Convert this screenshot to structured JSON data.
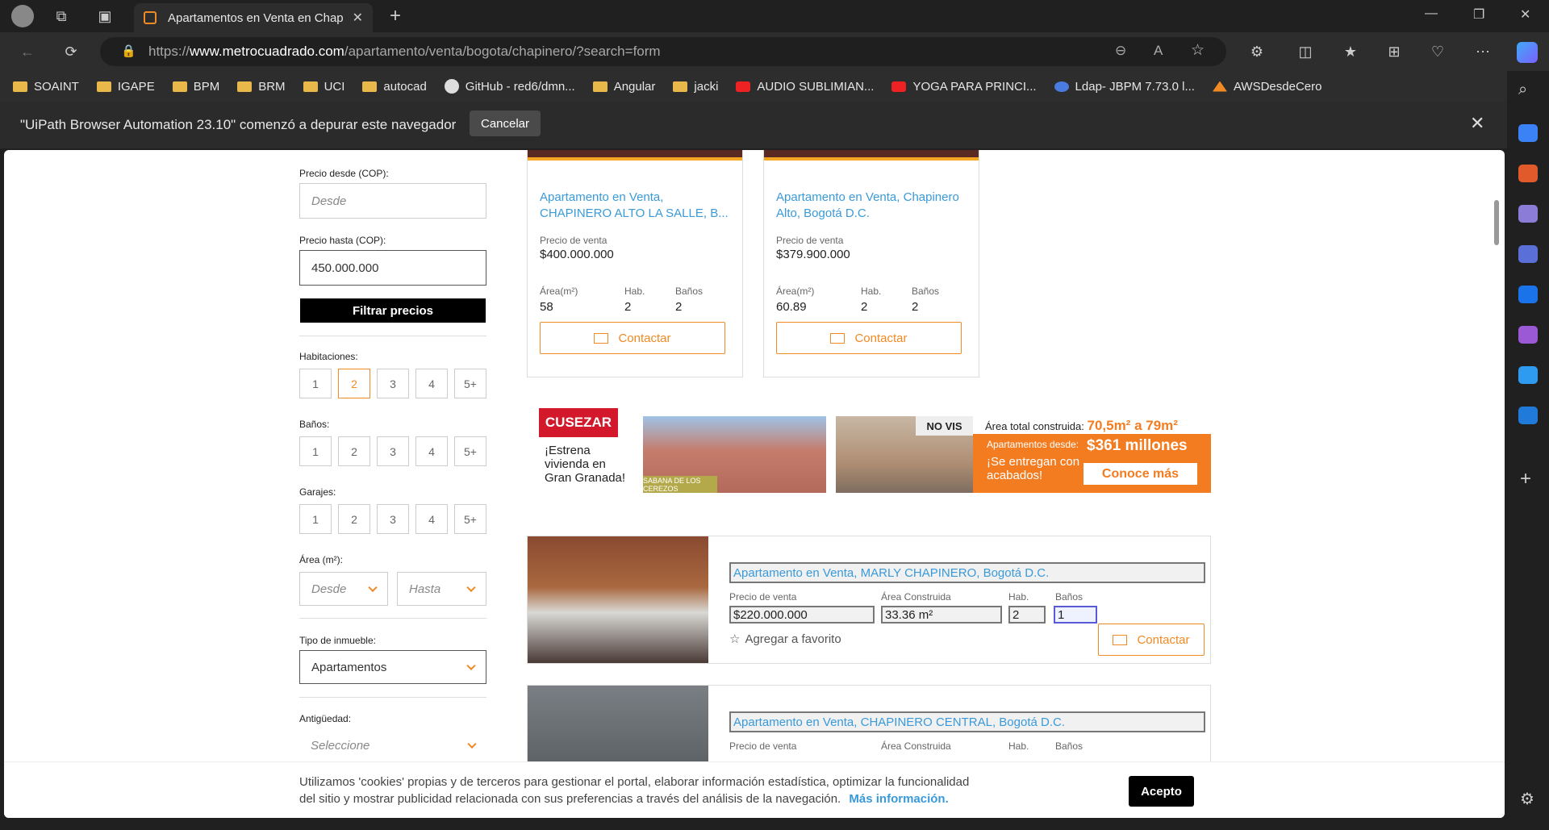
{
  "browser": {
    "tab_title": "Apartamentos en Venta en Chap",
    "url_prefix": "https://",
    "url_domain": "www.metrocuadrado.com",
    "url_path": "/apartamento/venta/bogota/chapinero/?search=form",
    "bookmarks": [
      {
        "label": "SOAINT",
        "icon": "folder-icon"
      },
      {
        "label": "IGAPE",
        "icon": "folder-icon"
      },
      {
        "label": "BPM",
        "icon": "folder-icon"
      },
      {
        "label": "BRM",
        "icon": "folder-icon"
      },
      {
        "label": "UCI",
        "icon": "folder-icon"
      },
      {
        "label": "autocad",
        "icon": "folder-icon"
      },
      {
        "label": "GitHub - red6/dmn...",
        "icon": "github-icon"
      },
      {
        "label": "Angular",
        "icon": "folder-icon"
      },
      {
        "label": "jacki",
        "icon": "folder-icon"
      },
      {
        "label": "AUDIO SUBLIMIAN...",
        "icon": "youtube-icon"
      },
      {
        "label": "YOGA PARA PRINCI...",
        "icon": "youtube-icon"
      },
      {
        "label": "Ldap- JBPM 7.73.0 l...",
        "icon": "people-icon"
      },
      {
        "label": "AWSDesdeCero",
        "icon": "aws-icon"
      }
    ],
    "infobar_text": "\"UiPath Browser Automation 23.10\" comenzó a depurar este navegador",
    "infobar_cancel": "Cancelar"
  },
  "filters": {
    "precio_desde_label": "Precio desde (COP):",
    "precio_desde_placeholder": "Desde",
    "precio_hasta_label": "Precio hasta (COP):",
    "precio_hasta_value": "450.000.000",
    "filtrar_label": "Filtrar precios",
    "habitaciones_label": "Habitaciones:",
    "habitaciones_options": [
      "1",
      "2",
      "3",
      "4",
      "5+"
    ],
    "habitaciones_selected": "2",
    "banos_label": "Baños:",
    "banos_options": [
      "1",
      "2",
      "3",
      "4",
      "5+"
    ],
    "garajes_label": "Garajes:",
    "garajes_options": [
      "1",
      "2",
      "3",
      "4",
      "5+"
    ],
    "area_label": "Área (m²):",
    "area_desde": "Desde",
    "area_hasta": "Hasta",
    "tipo_label": "Tipo de inmueble:",
    "tipo_value": "Apartamentos",
    "antiguedad_label": "Antigüedad:",
    "antiguedad_value": "Seleccione"
  },
  "grid_cards": [
    {
      "title": "Apartamento en Venta, CHAPINERO ALTO LA SALLE, B...",
      "price_label": "Precio de venta",
      "price": "$400.000.000",
      "area_label": "Área(m²)",
      "area": "58",
      "hab_label": "Hab.",
      "hab": "2",
      "banos_label": "Baños",
      "banos": "2",
      "contact": "Contactar"
    },
    {
      "title": "Apartamento en Venta, Chapinero Alto, Bogotá D.C.",
      "price_label": "Precio de venta",
      "price": "$379.900.000",
      "area_label": "Área(m²)",
      "area": "60.89",
      "hab_label": "Hab.",
      "hab": "2",
      "banos_label": "Baños",
      "banos": "2",
      "contact": "Contactar"
    }
  ],
  "ad": {
    "brand": "CUSEZAR",
    "tagline": "¡Estrena vivienda en Gran Granada!",
    "project": "SABANA DE LOS CEREZOS",
    "badge": "NO VIS",
    "area_text": "Área total construida:",
    "area_value": "70,5m² a 79m²",
    "desde_text": "Apartamentos desde:",
    "price": "$361 millones",
    "entregan": "¡Se entregan con acabados!",
    "cta": "Conoce más"
  },
  "list_cards": [
    {
      "title": "Apartamento en Venta, MARLY CHAPINERO, Bogotá D.C.",
      "price_label": "Precio de venta",
      "price": "$220.000.000",
      "area_label": "Área Construida",
      "area": "33.36 m²",
      "hab_label": "Hab.",
      "hab": "2",
      "banos_label": "Baños",
      "banos": "1",
      "fav": "Agregar a favorito",
      "contact": "Contactar"
    },
    {
      "title": "Apartamento en Venta, CHAPINERO CENTRAL, Bogotá D.C.",
      "price_label": "Precio de venta",
      "area_label": "Área Construida",
      "hab_label": "Hab.",
      "banos_label": "Baños"
    }
  ],
  "cookie": {
    "text": "Utilizamos 'cookies' propias y de terceros para gestionar el portal, elaborar información estadística, optimizar la funcionalidad del sitio y mostrar publicidad relacionada con sus preferencias a través del análisis de la navegación.",
    "more": "Más información.",
    "accept": "Acepto"
  },
  "colors": {
    "accent": "#f08a24",
    "link": "#3a9ad9",
    "ad_orange": "#f47c20",
    "ad_red": "#d3182c"
  }
}
